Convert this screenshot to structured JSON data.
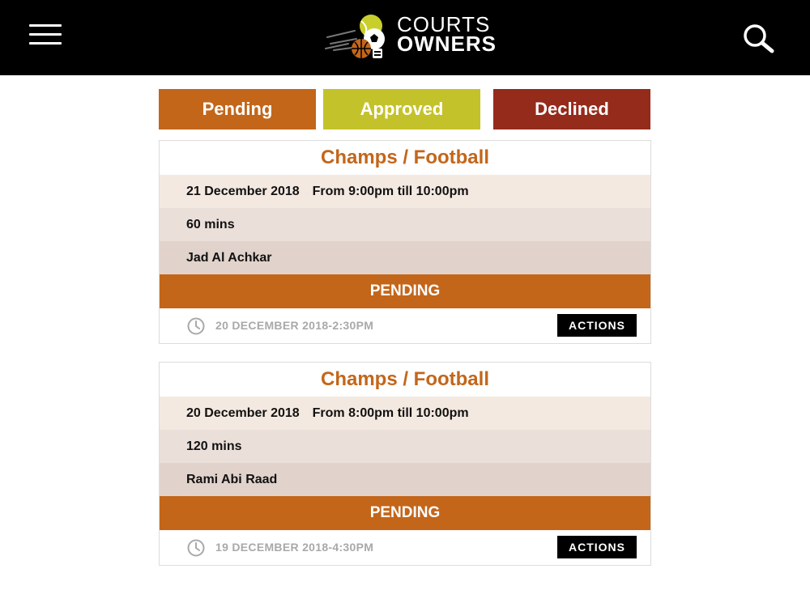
{
  "header": {
    "logo": {
      "line1": "COURTS",
      "line2": "OWNERS",
      "icon": "sports-balls-logo-icon"
    },
    "menu_icon": "hamburger-menu-icon",
    "search_icon": "search-icon"
  },
  "tabs": [
    {
      "label": "Pending",
      "color": "#c3661a"
    },
    {
      "label": "Approved",
      "color": "#c4c22a"
    },
    {
      "label": "Declined",
      "color": "#952b1b"
    }
  ],
  "bookings": [
    {
      "title": "Champs / Football",
      "date": "21 December 2018",
      "time": "From 9:00pm till 10:00pm",
      "duration": "60 mins",
      "customer": "Jad Al Achkar",
      "status": "PENDING",
      "created": "20 DECEMBER 2018-2:30PM",
      "actions_label": "ACTIONS"
    },
    {
      "title": "Champs / Football",
      "date": "20 December 2018",
      "time": "From 8:00pm till 10:00pm",
      "duration": "120 mins",
      "customer": "Rami Abi Raad",
      "status": "PENDING",
      "created": "19 DECEMBER 2018-4:30PM",
      "actions_label": "ACTIONS"
    }
  ],
  "colors": {
    "accent": "#c3661a",
    "approved": "#c4c22a",
    "declined": "#952b1b",
    "header_bg": "#000000"
  }
}
